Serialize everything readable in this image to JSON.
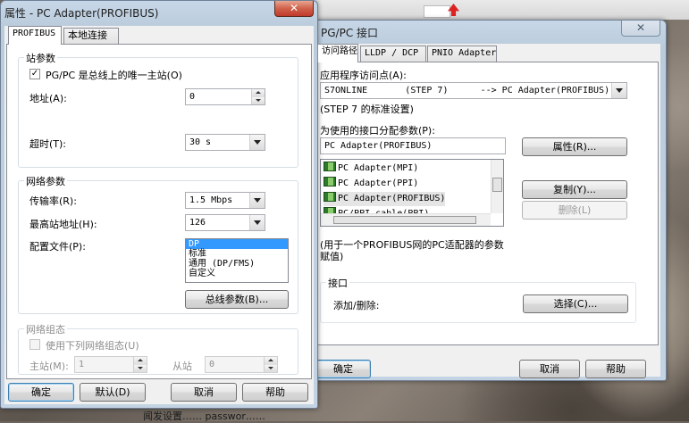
{
  "desktop": {
    "background_text": "闻发设置…… passwor……"
  },
  "pgpc_window": {
    "title": "PG/PC 接口",
    "tabs": [
      "访问路径",
      "LLDP / DCP",
      "PNIO Adapter"
    ],
    "access_point_label": "应用程序访问点(A):",
    "access_point_value": "S7ONLINE       (STEP 7)      --> PC Adapter(PROFIBUS)",
    "access_point_desc": "(STEP 7 的标准设置)",
    "param_label": "为使用的接口分配参数(P):",
    "param_value": "PC Adapter(PROFIBUS)",
    "properties_button": "属性(R)...",
    "interfaces": [
      "PC Adapter(MPI)",
      "PC Adapter(PPI)",
      "PC Adapter(PROFIBUS)",
      "PC/PPI cable(PPI)"
    ],
    "copy_button": "复制(Y)...",
    "delete_button": "删除(L)",
    "description": "(用于一个PROFIBUS网的PC适配器的参数赋值)",
    "interfaces_group": "接口",
    "add_remove_label": "添加/删除:",
    "select_button": "选择(C)...",
    "ok_button": "确定",
    "cancel_button": "取消",
    "help_button": "帮助"
  },
  "props_window": {
    "title": "属性 - PC Adapter(PROFIBUS)",
    "tabs": [
      "PROFIBUS",
      "本地连接"
    ],
    "station_group": "站参数",
    "only_master_label": "PG/PC 是总线上的唯一主站(O)",
    "only_master_checked": "✓",
    "address_label": "地址(A):",
    "address_value": "0",
    "timeout_label": "超时(T):",
    "timeout_value": "30 s",
    "network_group": "网络参数",
    "baud_label": "传输率(R):",
    "baud_value": "1.5 Mbps",
    "highest_addr_label": "最高站地址(H):",
    "highest_addr_value": "126",
    "profile_label": "配置文件(P):",
    "profiles": [
      "DP",
      "标准",
      "通用 (DP/FMS)",
      "自定义"
    ],
    "bus_params_button": "总线参数(B)...",
    "topology_group": "网络组态",
    "use_topology_label": "使用下列网络组态(U)",
    "master_label": "主站(M):",
    "master_value": "1",
    "slave_label": "从站",
    "slave_value": "0",
    "ok_button": "确定",
    "default_button": "默认(D)",
    "cancel_button": "取消",
    "help_button": "帮助",
    "close_symbol": "✕"
  },
  "colors": {
    "selection": "#3399ff",
    "close_button": "#c0392b"
  }
}
